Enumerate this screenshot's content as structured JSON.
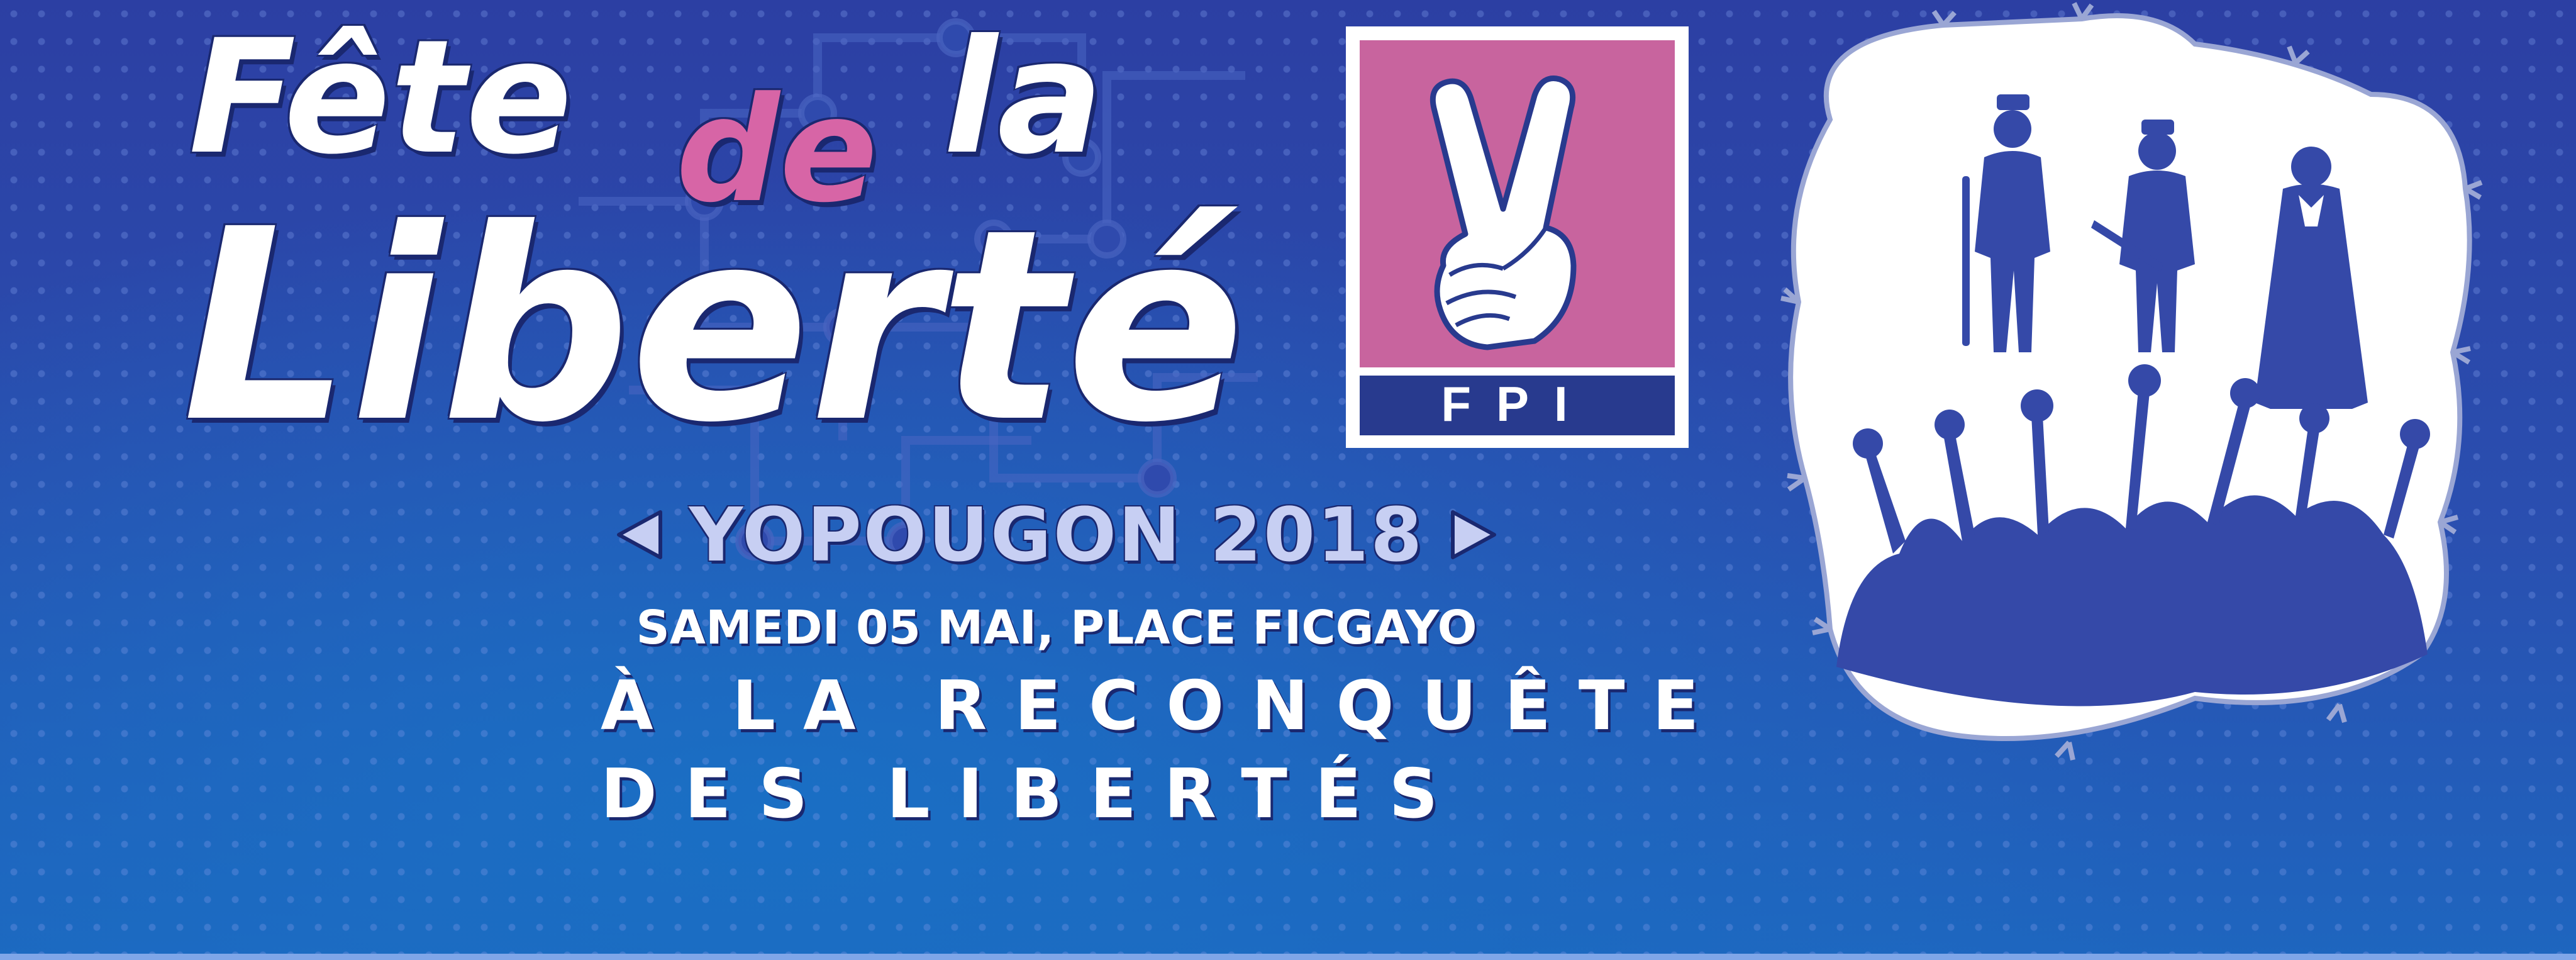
{
  "title": {
    "word_fete": "Fête",
    "word_de": "de",
    "word_la": "la",
    "word_liberte": "Liberté"
  },
  "logo": {
    "icon": "victory-hand-icon",
    "label": "FPI"
  },
  "event": {
    "location_year": "YOPOUGON 2018",
    "date_place": "SAMEDI 05 MAI, PLACE FICGAYO",
    "slogan_line_1": "À LA RECONQUÊTE",
    "slogan_line_2": "DES LIBERTÉS"
  },
  "colors": {
    "background": "#2a48a8",
    "accent_pink": "#d765a6",
    "logo_pink": "#c8649e",
    "logo_navy": "#283a8e",
    "text_white": "#ffffff",
    "text_lavender": "#c7cff3",
    "silhouette": "#3549a8"
  }
}
